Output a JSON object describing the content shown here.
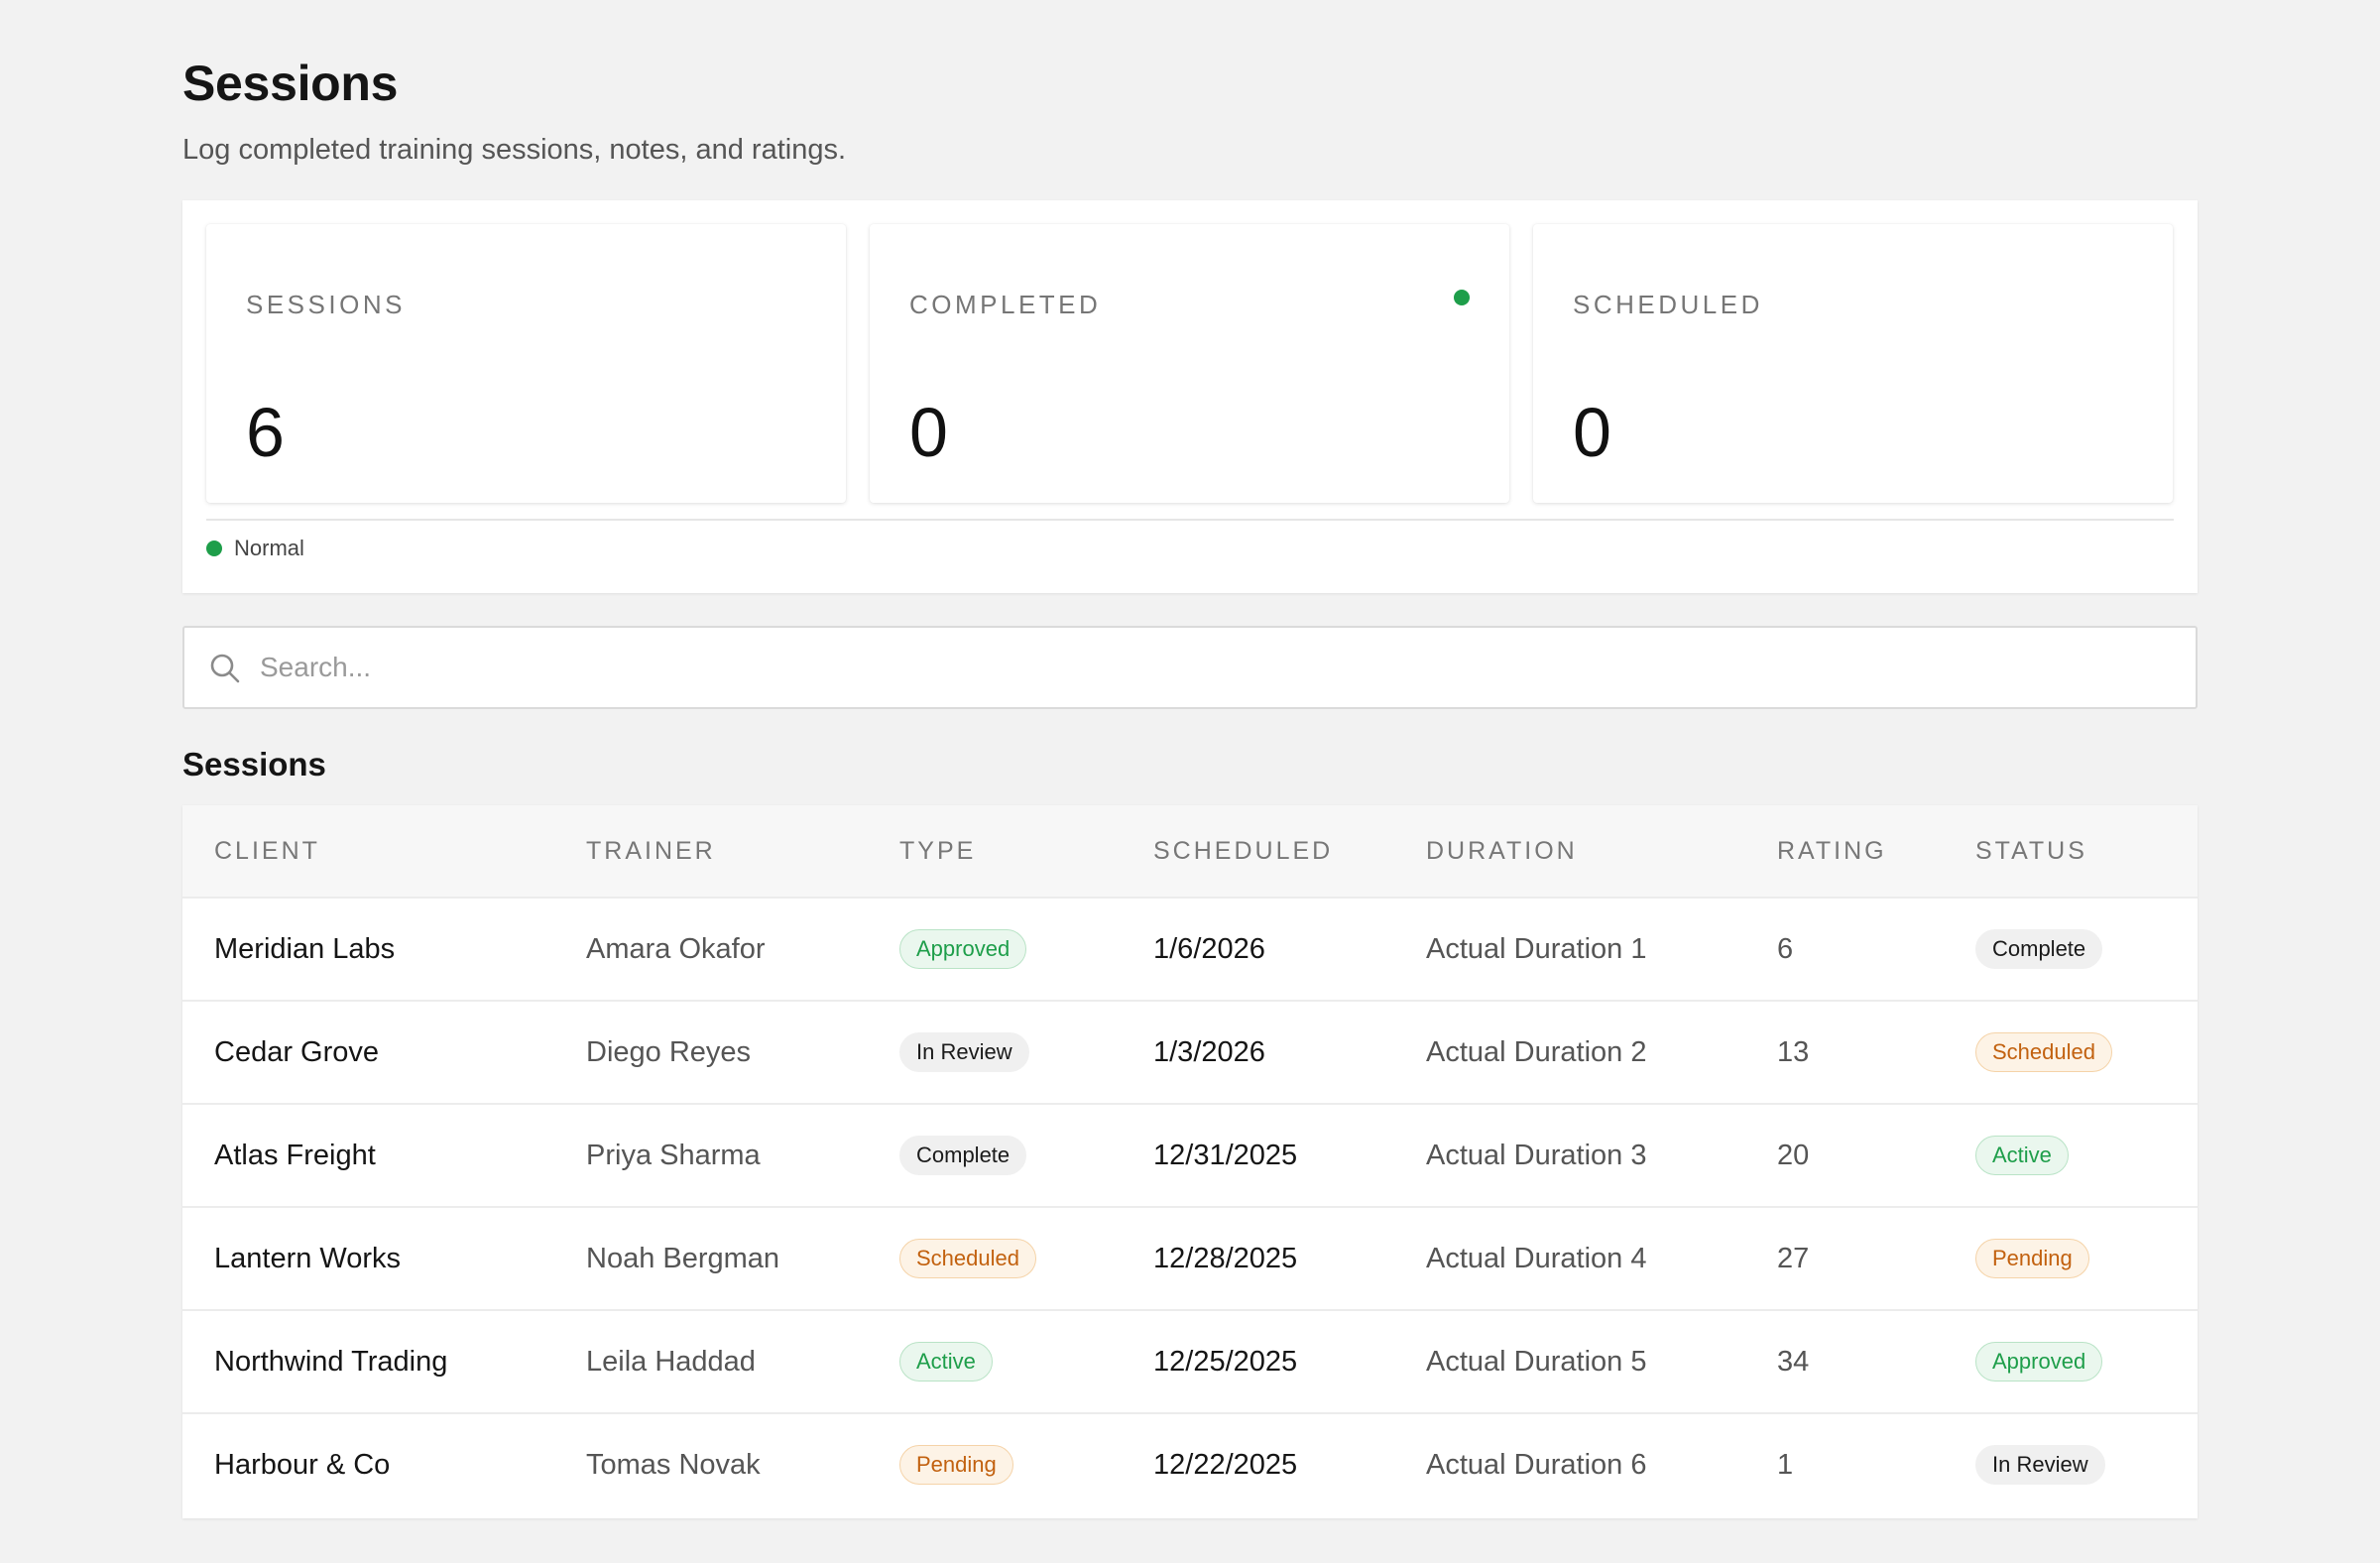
{
  "header": {
    "title": "Sessions",
    "subtitle": "Log completed training sessions, notes, and ratings."
  },
  "stats": [
    {
      "label": "SESSIONS",
      "value": "6"
    },
    {
      "label": "COMPLETED",
      "value": "0"
    },
    {
      "label": "SCHEDULED",
      "value": "0"
    }
  ],
  "status_indicator": {
    "label": "Normal",
    "color": "#1e9e4a"
  },
  "search": {
    "placeholder": "Search...",
    "value": ""
  },
  "table": {
    "title": "Sessions",
    "columns": [
      "CLIENT",
      "TRAINER",
      "TYPE",
      "SCHEDULED",
      "DURATION",
      "RATING",
      "STATUS"
    ],
    "rows": [
      {
        "client": "Meridian Labs",
        "trainer": "Amara Okafor",
        "type": "Approved",
        "scheduled": "1/6/2026",
        "duration": "Actual Duration 1",
        "rating": "6",
        "status": "Complete"
      },
      {
        "client": "Cedar Grove",
        "trainer": "Diego Reyes",
        "type": "In Review",
        "scheduled": "1/3/2026",
        "duration": "Actual Duration 2",
        "rating": "13",
        "status": "Scheduled"
      },
      {
        "client": "Atlas Freight",
        "trainer": "Priya Sharma",
        "type": "Complete",
        "scheduled": "12/31/2025",
        "duration": "Actual Duration 3",
        "rating": "20",
        "status": "Active"
      },
      {
        "client": "Lantern Works",
        "trainer": "Noah Bergman",
        "type": "Scheduled",
        "scheduled": "12/28/2025",
        "duration": "Actual Duration 4",
        "rating": "27",
        "status": "Pending"
      },
      {
        "client": "Northwind Trading",
        "trainer": "Leila Haddad",
        "type": "Active",
        "scheduled": "12/25/2025",
        "duration": "Actual Duration 5",
        "rating": "34",
        "status": "Approved"
      },
      {
        "client": "Harbour & Co",
        "trainer": "Tomas Novak",
        "type": "Pending",
        "scheduled": "12/22/2025",
        "duration": "Actual Duration 6",
        "rating": "1",
        "status": "In Review"
      }
    ]
  },
  "badge_colors": {
    "green": "#1e9e4a",
    "orange": "#c2610f",
    "gray": "#1a1a1a"
  }
}
